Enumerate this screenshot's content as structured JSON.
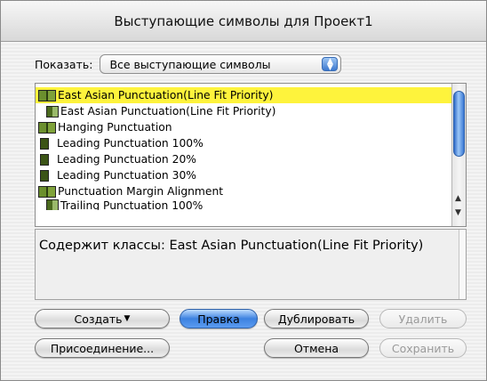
{
  "window": {
    "title": "Выступающие символы для Проект1"
  },
  "show": {
    "label": "Показать:",
    "selected": "Все выступающие символы"
  },
  "list": {
    "items": [
      {
        "label": "East Asian Punctuation(Line Fit Priority)",
        "selected": true
      },
      {
        "label": "East Asian Punctuation(Line Fit Priority)",
        "selected": false
      },
      {
        "label": "Hanging Punctuation",
        "selected": false
      },
      {
        "label": "Leading Punctuation 100%",
        "selected": false
      },
      {
        "label": "Leading Punctuation 20%",
        "selected": false
      },
      {
        "label": "Leading Punctuation 30%",
        "selected": false
      },
      {
        "label": "Punctuation Margin Alignment",
        "selected": false
      },
      {
        "label": "Trailing Punctuation 100%",
        "selected": false
      }
    ]
  },
  "description": "Содержит классы: East Asian Punctuation(Line Fit Priority)",
  "buttons": {
    "new": "Создать",
    "edit": "Правка",
    "duplicate": "Дублировать",
    "delete": "Удалить",
    "append": "Присоединение...",
    "cancel": "Отмена",
    "save": "Сохранить"
  }
}
